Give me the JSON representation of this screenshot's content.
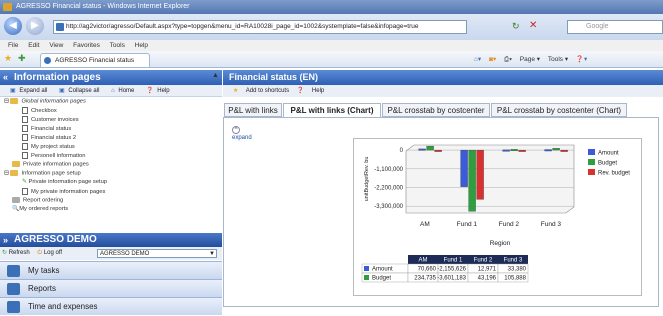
{
  "window": {
    "title": "AGRESSO Financial status - Windows Internet Explorer"
  },
  "address": {
    "url": "http://ag2victor/agresso/Default.aspx?type=topgen&menu_id=RA10028i_page_id=1002&systemplate=false&infopage=true"
  },
  "search": {
    "placeholder": "Google"
  },
  "menu": [
    "File",
    "Edit",
    "View",
    "Favorites",
    "Tools",
    "Help"
  ],
  "browser_tab": {
    "label": "AGRESSO Financial status"
  },
  "commands": [
    "Page ▾",
    "Tools ▾"
  ],
  "left": {
    "title": "Information pages",
    "tools": [
      "Expand all",
      "Collapse all",
      "Home",
      "Help"
    ],
    "tree": [
      {
        "label": "Global information pages",
        "type": "folder",
        "indent": 0,
        "italic": true
      },
      {
        "label": "Checkbox",
        "type": "doc",
        "indent": 1
      },
      {
        "label": "Customer invoices",
        "type": "doc",
        "indent": 1
      },
      {
        "label": "Financial status",
        "type": "doc",
        "indent": 1
      },
      {
        "label": "Financial status 2",
        "type": "doc",
        "indent": 1
      },
      {
        "label": "My project status",
        "type": "doc",
        "indent": 1
      },
      {
        "label": "Personell information",
        "type": "doc",
        "indent": 1
      },
      {
        "label": "Private information pages",
        "type": "folder",
        "indent": 0
      },
      {
        "label": "Information page setup",
        "type": "folder",
        "indent": 0
      },
      {
        "label": "Private information page setup",
        "type": "doc",
        "indent": 1
      },
      {
        "label": "My private information pages",
        "type": "doc",
        "indent": 1
      },
      {
        "label": "Report ordering",
        "type": "folder",
        "indent": 0
      },
      {
        "label": "My ordered reports",
        "type": "doc",
        "indent": 0
      }
    ],
    "demo_title": "AGRESSO DEMO",
    "demo_tools": [
      "Refresh",
      "Log off"
    ],
    "demo_select": "AGRESSO DEMO",
    "nav": [
      "My tasks",
      "Reports",
      "Time and expenses"
    ]
  },
  "right": {
    "title": "Financial status (EN)",
    "tools": [
      "Add to shortcuts",
      "Help"
    ],
    "tabs": [
      "P&L with links",
      "P&L with links (Chart)",
      "P&L crosstab by costcenter",
      "P&L crosstab by costcenter (Chart)"
    ],
    "active_tab": 1,
    "expand": "expand"
  },
  "chart_data": {
    "type": "bar",
    "categories": [
      "AM",
      "Fund 1",
      "Fund 2",
      "Fund 3"
    ],
    "series": [
      {
        "name": "Amount",
        "values": [
          70660,
          -2155626,
          12971,
          33380
        ],
        "color": "#3b5bdb"
      },
      {
        "name": "Budget",
        "values": [
          234735,
          -3601183,
          43196,
          105888
        ],
        "color": "#2e9e3e"
      },
      {
        "name": "Rev. budget",
        "values": [
          0,
          -2900000,
          0,
          0
        ],
        "color": "#d93030"
      }
    ],
    "ylabel": "unitBudgetRev. bu",
    "xlabel": "Region",
    "yticks": [
      "0",
      "-1,100,000",
      "-2,200,000",
      "-3,300,000"
    ],
    "ylim": [
      -3700000,
      300000
    ],
    "table": {
      "headers": [
        "AM",
        "Fund 1",
        "Fund 2",
        "Fund 3"
      ],
      "rows": [
        {
          "name": "Amount",
          "values": [
            "70,660",
            "-2,155,626",
            "12,971",
            "33,380"
          ]
        },
        {
          "name": "Budget",
          "values": [
            "234,735",
            "-3,601,183",
            "43,196",
            "105,888"
          ]
        }
      ]
    },
    "legend": "right"
  }
}
